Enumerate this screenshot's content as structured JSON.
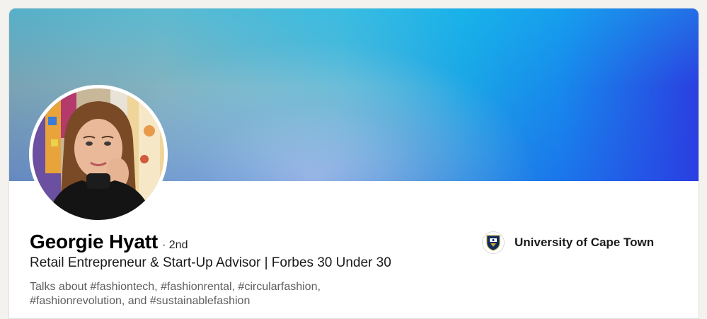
{
  "profile": {
    "name": "Georgie Hyatt",
    "degree": "· 2nd",
    "headline": "Retail Entrepreneur & Start-Up Advisor | Forbes 30 Under 30",
    "talks_about": "Talks about #fashiontech, #fashionrental, #circularfashion, #fashionrevolution, and #sustainablefashion",
    "avatar_icon": "profile-photo"
  },
  "education": {
    "school": "University of Cape Town",
    "logo_icon": "university-crest-icon"
  },
  "colors": {
    "banner_start": "#7aa3b4",
    "banner_mid": "#1aa6e6",
    "banner_end": "#2b3ee0"
  }
}
